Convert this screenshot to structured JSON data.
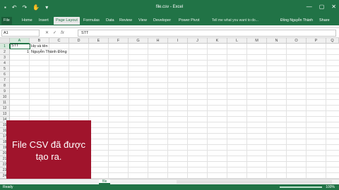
{
  "titlebar": {
    "title": "file.csv - Excel",
    "qat": [
      "save-icon",
      "undo-icon",
      "redo-icon",
      "touch-icon",
      "customize-icon"
    ],
    "qat_glyphs": [
      "▪",
      "↶",
      "↷",
      "✋",
      "▾"
    ],
    "controls": [
      "—",
      "▢",
      "✕"
    ]
  },
  "tabs": {
    "file": "File",
    "items": [
      "Home",
      "Insert",
      "Page Layout",
      "Formulas",
      "Data",
      "Review",
      "View",
      "Developer",
      "Power Pivot"
    ],
    "active": "Page Layout",
    "tell_me": "Tell me what you want to do...",
    "user": "Đồng Nguyễn Thành",
    "share": "Share"
  },
  "formula": {
    "name_box": "A1",
    "cancel": "✕",
    "enter": "✓",
    "fx": "fx",
    "value": "STT"
  },
  "columns": [
    "A",
    "B",
    "C",
    "D",
    "E",
    "F",
    "G",
    "H",
    "I",
    "J",
    "K",
    "L",
    "M",
    "N",
    "O",
    "P",
    "Q"
  ],
  "rows": [
    "1",
    "2",
    "3",
    "4",
    "5",
    "6",
    "7",
    "8",
    "9",
    "10",
    "11",
    "12",
    "13",
    "14",
    "15",
    "16",
    "17",
    "18",
    "19",
    "20",
    "21",
    "22",
    "23",
    "24"
  ],
  "cells": {
    "a1": "STT",
    "b1": "Họ và tên",
    "a2": "1",
    "b2": "Nguyễn Thành Đồng"
  },
  "overlay": {
    "text": "File CSV đã được tạo ra."
  },
  "sheet": {
    "tab": "file"
  },
  "status": {
    "left": "Ready",
    "zoom": "100%"
  },
  "colors": {
    "accent": "#217346",
    "overlay": "#a0142c"
  }
}
